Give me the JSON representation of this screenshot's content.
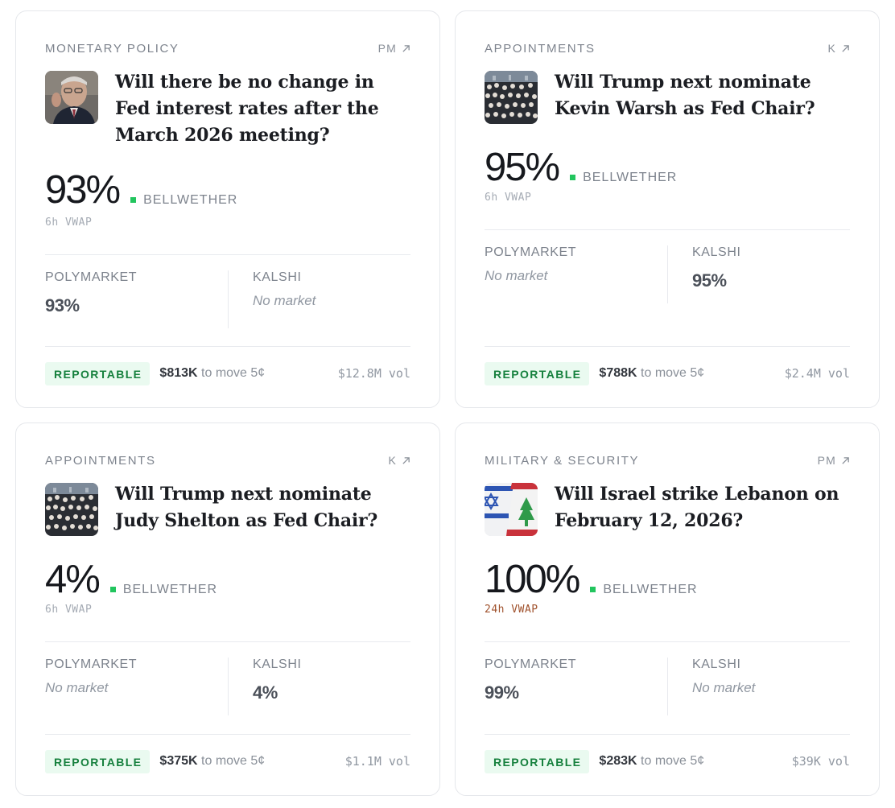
{
  "cards": [
    {
      "category": "MONETARY POLICY",
      "source": "PM",
      "image": "fed-chair-photo",
      "question": "Will there be no change in Fed interest rates after the March 2026 meeting?",
      "probability": "93%",
      "bellwether_label": "BELLWETHER",
      "vwap": "6h VWAP",
      "polymarket_label": "POLYMARKET",
      "polymarket_value": "93%",
      "kalshi_label": "KALSHI",
      "kalshi_value": "No market",
      "badge": "REPORTABLE",
      "move_amount": "$813K",
      "move_text": "to move 5¢",
      "volume": "$12.8M vol"
    },
    {
      "category": "APPOINTMENTS",
      "source": "K",
      "image": "crowd-photo",
      "question": "Will Trump next nominate Kevin Warsh as Fed Chair?",
      "probability": "95%",
      "bellwether_label": "BELLWETHER",
      "vwap": "6h VWAP",
      "polymarket_label": "POLYMARKET",
      "polymarket_value": "No market",
      "kalshi_label": "KALSHI",
      "kalshi_value": "95%",
      "badge": "REPORTABLE",
      "move_amount": "$788K",
      "move_text": "to move 5¢",
      "volume": "$2.4M vol"
    },
    {
      "category": "APPOINTMENTS",
      "source": "K",
      "image": "crowd-photo",
      "question": "Will Trump next nominate Judy Shelton as Fed Chair?",
      "probability": "4%",
      "bellwether_label": "BELLWETHER",
      "vwap": "6h VWAP",
      "polymarket_label": "POLYMARKET",
      "polymarket_value": "No market",
      "kalshi_label": "KALSHI",
      "kalshi_value": "4%",
      "badge": "REPORTABLE",
      "move_amount": "$375K",
      "move_text": "to move 5¢",
      "volume": "$1.1M vol"
    },
    {
      "category": "MILITARY & SECURITY",
      "source": "PM",
      "image": "israel-lebanon-flags",
      "question": "Will Israel strike Lebanon on February 12, 2026?",
      "probability": "100%",
      "bellwether_label": "BELLWETHER",
      "vwap": "24h VWAP",
      "polymarket_label": "POLYMARKET",
      "polymarket_value": "99%",
      "kalshi_label": "KALSHI",
      "kalshi_value": "No market",
      "badge": "REPORTABLE",
      "move_amount": "$283K",
      "move_text": "to move 5¢",
      "volume": "$39K vol"
    }
  ],
  "colors": {
    "bellwether_dot": "#22c55e",
    "badge_bg": "#eafaf0",
    "badge_text": "#15803d",
    "vwap_warn": "#a0522d"
  }
}
